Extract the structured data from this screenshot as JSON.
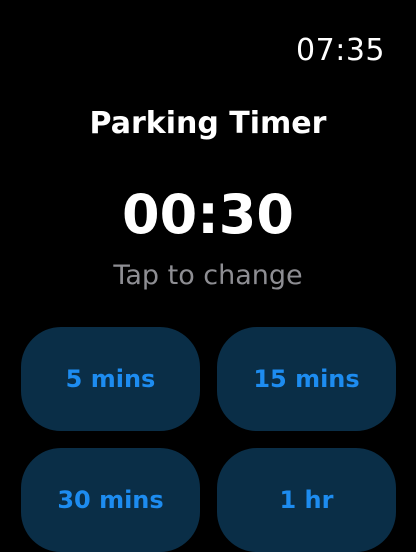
{
  "status": {
    "time": "07:35"
  },
  "screen": {
    "title": "Parking Timer",
    "timer_value": "00:30",
    "hint": "Tap to change"
  },
  "presets": [
    {
      "label": "5 mins"
    },
    {
      "label": "15 mins"
    },
    {
      "label": "30 mins"
    },
    {
      "label": "1 hr"
    }
  ],
  "colors": {
    "background": "#000000",
    "button_background": "#0a2e47",
    "accent": "#1d8cf0",
    "hint_text": "#8e8e93"
  }
}
